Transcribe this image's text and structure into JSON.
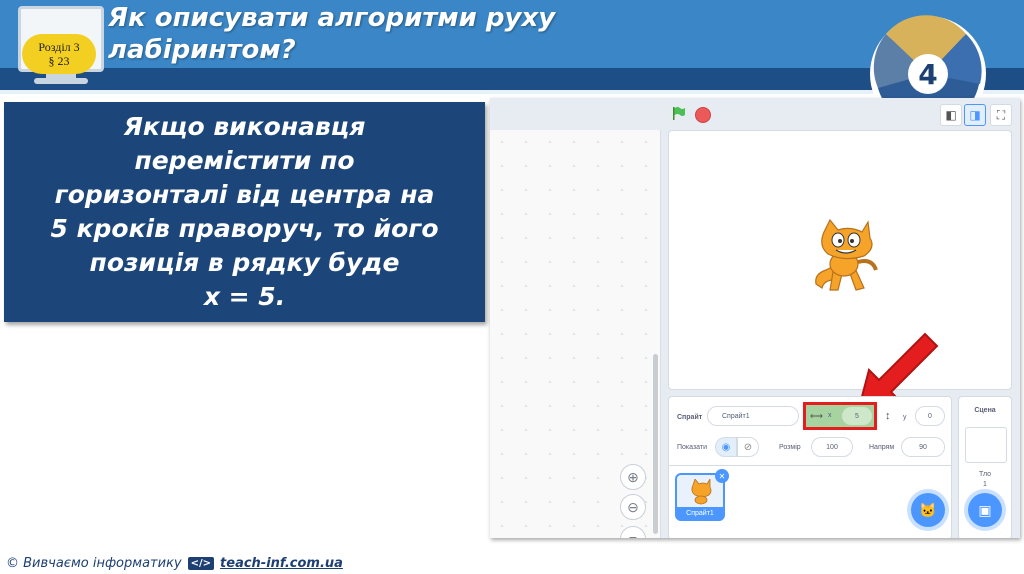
{
  "header": {
    "title_line1": "Як описувати алгоритми руху",
    "title_line2": "лабіринтом?",
    "badge_line1": "Розділ 3",
    "badge_line2": "§ 23",
    "logo_number": "4",
    "colors": {
      "bar": "#3a86c6",
      "bar_dark": "#1e4e86",
      "badge": "#f3cf22"
    }
  },
  "textbox": {
    "lines": [
      "Якщо виконавця",
      "перемістити по",
      "горизонталі від центра на",
      "5 кроків праворуч, то його",
      "позиція в рядку буде",
      "x = 5."
    ]
  },
  "scratch": {
    "icons": [
      "green-flag-icon",
      "stop-icon",
      "small-stage-icon",
      "large-stage-icon",
      "fullscreen-icon",
      "zoom-in-icon",
      "zoom-out-icon",
      "zoom-reset-icon",
      "show-icon",
      "hide-icon",
      "trash-icon",
      "choose-sprite-icon",
      "choose-backdrop-icon"
    ],
    "sprite_label": "Спрайт",
    "sprite_name": "Спрайт1",
    "x_label": "x",
    "x_value": "5",
    "y_label": "y",
    "y_value": "0",
    "show_label": "Показати",
    "size_label": "Розмір",
    "size_value": "100",
    "direction_label": "Напрям",
    "direction_value": "90",
    "thumb_label": "Спрайт1",
    "stage_panel_title": "Сцена",
    "backdrops_label": "Тло",
    "backdrops_count": "1"
  },
  "footer": {
    "copyright": "© Вивчаємо інформатику",
    "code_icon": "</>",
    "site": "teach-inf.com.ua"
  }
}
